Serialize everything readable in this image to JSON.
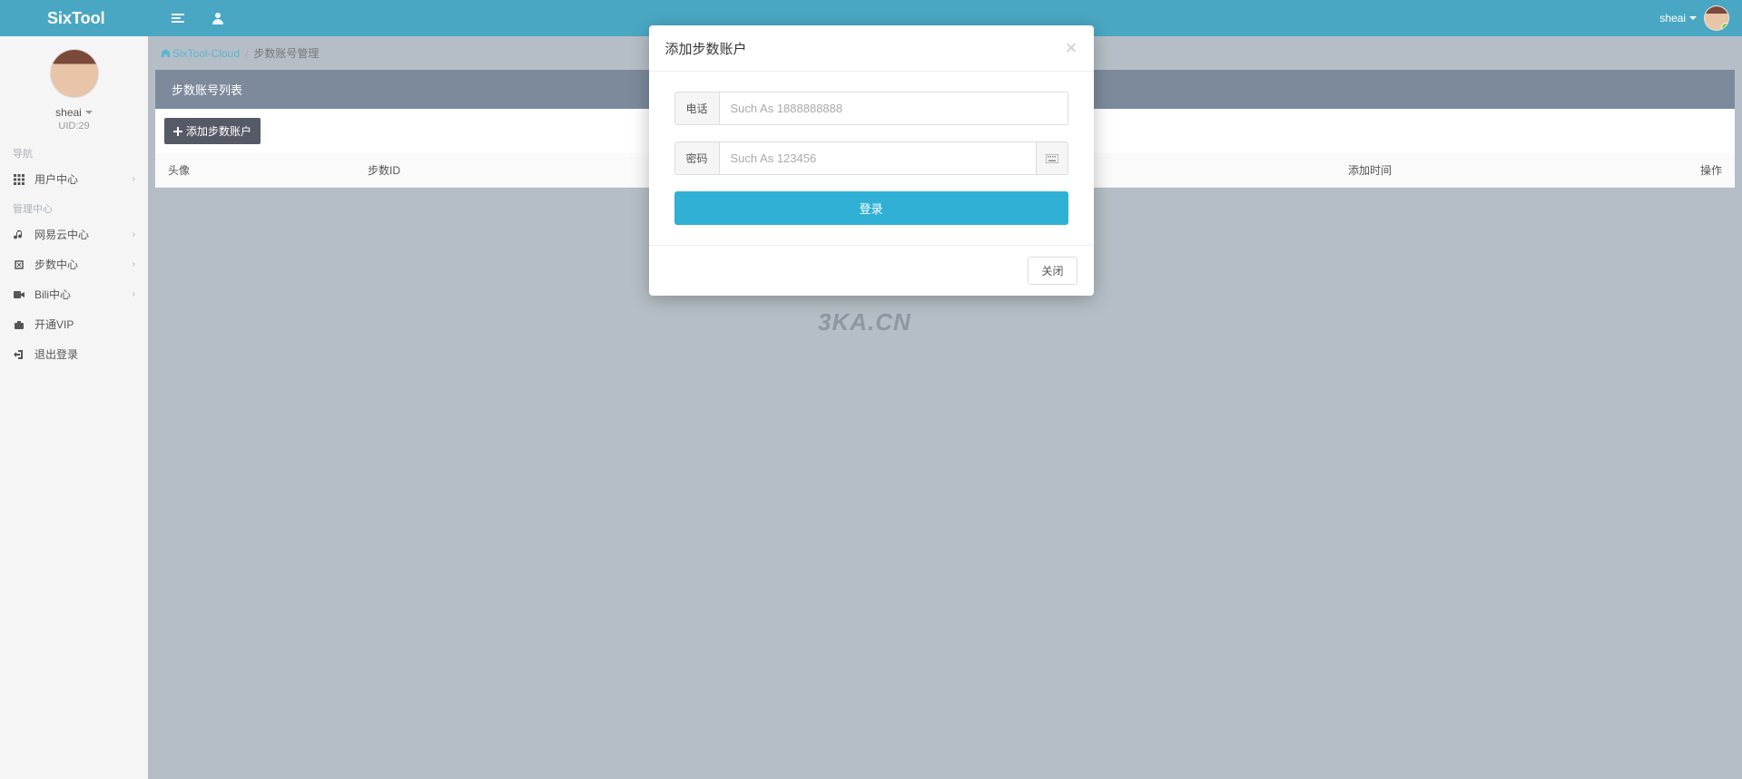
{
  "brand": "SixTool",
  "header": {
    "username": "sheai"
  },
  "profile": {
    "name": "sheai",
    "uid": "UID:29"
  },
  "sidebar": {
    "section1_header": "导航",
    "section2_header": "管理中心",
    "items": [
      {
        "label": "用户中心",
        "expandable": true
      },
      {
        "label": "网易云中心",
        "expandable": true
      },
      {
        "label": "步数中心",
        "expandable": true
      },
      {
        "label": "Bili中心",
        "expandable": true
      },
      {
        "label": "开通VIP",
        "expandable": false
      },
      {
        "label": "退出登录",
        "expandable": false
      }
    ]
  },
  "breadcrumb": {
    "home": "SixTool-Cloud",
    "current": "步数账号管理"
  },
  "panel": {
    "title": "步数账号列表",
    "add_button": "添加步数账户",
    "columns": [
      "头像",
      "步数ID",
      "添加时间",
      "操作"
    ]
  },
  "watermark": "3KA.CN",
  "modal": {
    "title": "添加步数账户",
    "phone_label": "电话",
    "phone_placeholder": "Such As 1888888888",
    "password_label": "密码",
    "password_placeholder": "Such As 123456",
    "login_button": "登录",
    "close_button": "关闭"
  }
}
